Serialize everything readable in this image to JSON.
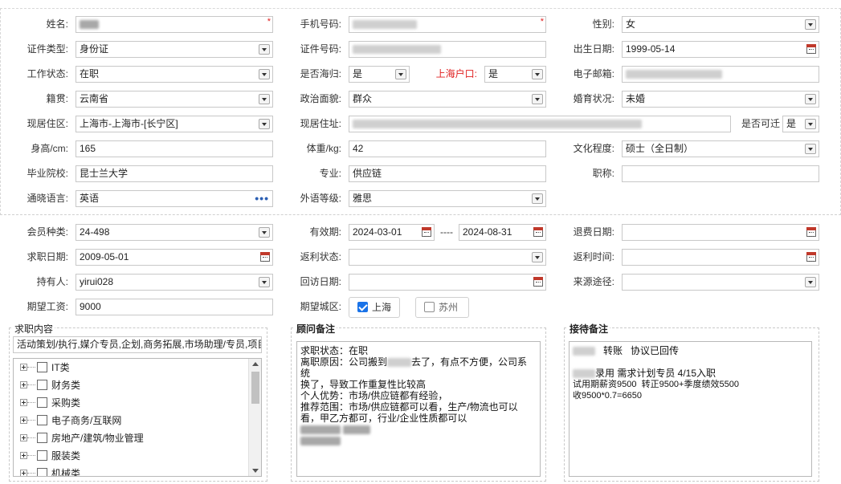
{
  "personal": {
    "name_label": "姓名:",
    "phone_label": "手机号码:",
    "gender_label": "性别:",
    "gender": "女",
    "id_type_label": "证件类型:",
    "id_type": "身份证",
    "id_no_label": "证件号码:",
    "birth_label": "出生日期:",
    "birth": "1999-05-14",
    "work_status_label": "工作状态:",
    "work_status": "在职",
    "overseas_label": "是否海归:",
    "overseas": "是",
    "hukou_label": "上海户口:",
    "hukou": "是",
    "email_label": "电子邮箱:",
    "native_label": "籍贯:",
    "native": "云南省",
    "political_label": "政治面貌:",
    "political": "群众",
    "marital_label": "婚育状况:",
    "marital": "未婚",
    "district_label": "现居住区:",
    "district": "上海市-上海市-[长宁区]",
    "address_label": "现居住址:",
    "relocate_label": "是否可迁",
    "relocate": "是",
    "height_label": "身高/cm:",
    "height": "165",
    "weight_label": "体重/kg:",
    "weight": "42",
    "education_label": "文化程度:",
    "education": "硕士（全日制）",
    "school_label": "毕业院校:",
    "school": "昆士兰大学",
    "major_label": "专业:",
    "major": "供应链",
    "title_label": "职称:",
    "title": "",
    "language_label": "通晓语言:",
    "language": "英语",
    "lang_level_label": "外语等级:",
    "lang_level": "雅思"
  },
  "membership": {
    "member_type_label": "会员种类:",
    "member_type": "24-498",
    "validity_label": "有效期:",
    "valid_from": "2024-03-01",
    "valid_sep": "----",
    "valid_to": "2024-08-31",
    "refund_date_label": "退费日期:",
    "apply_date_label": "求职日期:",
    "apply_date": "2009-05-01",
    "rebate_status_label": "返利状态:",
    "rebate_time_label": "返利时间:",
    "holder_label": "持有人:",
    "holder": "yirui028",
    "visit_date_label": "回访日期:",
    "source_label": "来源途径:",
    "salary_label": "期望工资:",
    "salary": "9000",
    "city_label": "期望城区:",
    "city_shanghai": "上海",
    "city_suzhou": "苏州"
  },
  "job_content": {
    "title": "求职内容",
    "summary": "活动策划/执行,媒介专员,企划,商务拓展,市场助理/专员,项目",
    "categories": [
      "IT类",
      "财务类",
      "采购类",
      "电子商务/互联网",
      "房地产/建筑/物业管理",
      "服装类",
      "机械类"
    ]
  },
  "advisor_notes": {
    "title": "顾问备注",
    "lines": [
      "求职状态：在职",
      "离职原因：公司搬到",
      "去了，有点不方便，公司系统",
      "换了，导致工作重复性比较高",
      "个人优势：市场/供应链都有经验，",
      "推荐范围：市场/供应链都可以看，生产/物流也可以",
      "看，甲乙方都可，行业/企业性质都可以"
    ]
  },
  "reception_notes": {
    "title": "接待备注",
    "line1_a": "转账",
    "line1_b": "协议已回传",
    "line2": "录用 需求计划专员 4/15入职",
    "line3": "试用期薪资9500  转正9500+季度绩效5500",
    "line4": "收9500*0.7=6650"
  }
}
